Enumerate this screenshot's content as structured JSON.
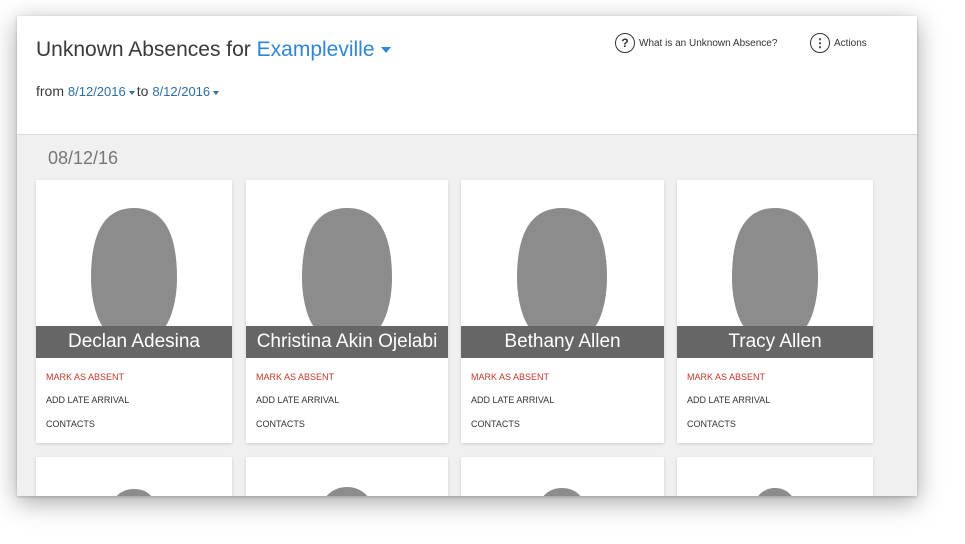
{
  "header": {
    "title_prefix": "Unknown Absences for",
    "school": "Exampleville",
    "from_label": "from",
    "from_date": "8/12/2016",
    "to_label": "to",
    "to_date": "8/12/2016",
    "help_label": "What is an Unknown Absence?",
    "actions_label": "Actions",
    "help_icon": "question-circle-icon",
    "actions_icon": "more-vertical-circle-icon"
  },
  "date_heading": "08/12/16",
  "students": [
    {
      "name": "Declan Adesina",
      "actions": [
        "MARK AS ABSENT",
        "ADD LATE ARRIVAL",
        "CONTACTS"
      ]
    },
    {
      "name": "Christina Akin Ojelabi",
      "actions": [
        "MARK AS ABSENT",
        "ADD LATE ARRIVAL",
        "CONTACTS"
      ]
    },
    {
      "name": "Bethany Allen",
      "actions": [
        "MARK AS ABSENT",
        "ADD LATE ARRIVAL",
        "CONTACTS"
      ]
    },
    {
      "name": "Tracy Allen",
      "actions": [
        "MARK AS ABSENT",
        "ADD LATE ARRIVAL",
        "CONTACTS"
      ]
    }
  ],
  "colors": {
    "accent": "#2f86d6",
    "mark_absent": "#c0392b",
    "name_band": "#666666",
    "silhouette": "#8c8c8c"
  }
}
